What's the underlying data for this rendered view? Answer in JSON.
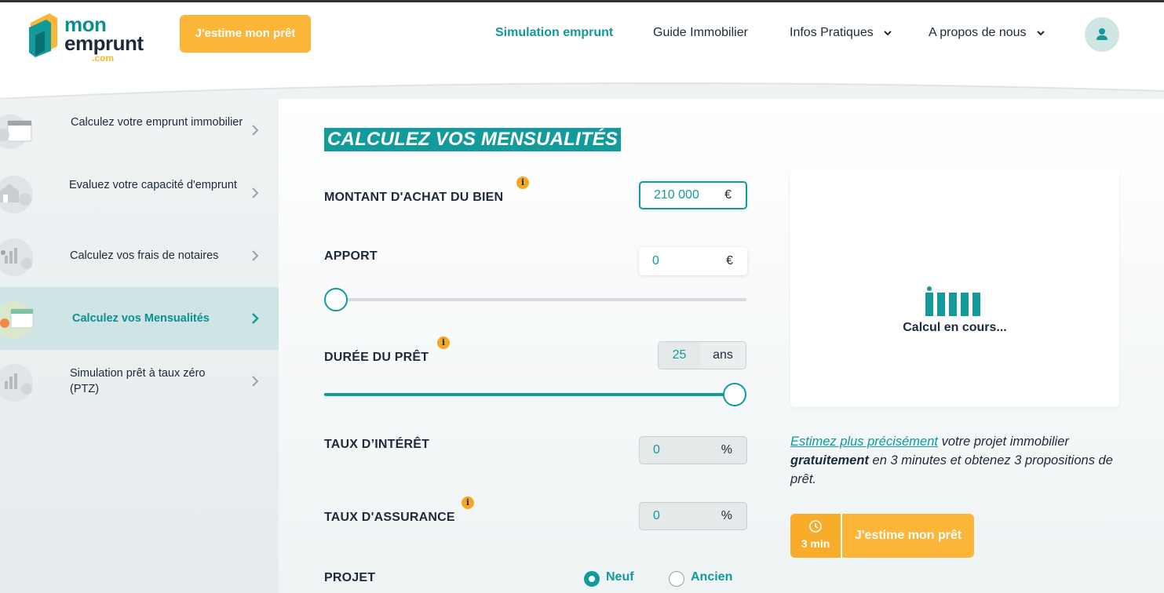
{
  "header": {
    "logo": {
      "line1": "mon",
      "line2": "emprunt",
      "line3": ".com"
    },
    "cta_label": "J'estime mon prêt",
    "nav": [
      {
        "label": "Simulation emprunt",
        "active": true
      },
      {
        "label": "Guide Immobilier"
      },
      {
        "label": "Infos Pratiques",
        "dropdown": true
      },
      {
        "label": "A propos de nous",
        "dropdown": true
      }
    ],
    "user_icon": "user-icon"
  },
  "sidebar": {
    "items": [
      {
        "label": "Calculez votre emprunt immobilier",
        "icon": "calendar-thumb-icon"
      },
      {
        "label": "Evaluez votre capacité d'emprunt",
        "icon": "house-thumb-icon"
      },
      {
        "label": "Calculez vos frais de notaires",
        "icon": "chart-thumb-icon"
      },
      {
        "label": "Calculez vos Mensualités",
        "icon": "calendar-thumb-icon",
        "active": true
      },
      {
        "label": "Simulation prêt à taux zéro (PTZ)",
        "icon": "chart-thumb-icon"
      }
    ]
  },
  "form": {
    "title": "CALCULEZ VOS MENSUALITÉS",
    "montant": {
      "label": "MONTANT D'ACHAT DU BIEN",
      "value": "210 000",
      "unit": "€"
    },
    "apport": {
      "label": "APPORT",
      "value": "0",
      "unit": "€",
      "slider_fraction": 0
    },
    "duree": {
      "label": "DURÉE DU PRÊT",
      "value": "25",
      "unit": "ans",
      "slider_fraction": 1
    },
    "taux_interet": {
      "label": "TAUX D’INTÉRÊT",
      "value": "0",
      "unit": "%"
    },
    "taux_assurance": {
      "label": "TAUX D'ASSURANCE",
      "value": "0",
      "unit": "%"
    },
    "projet": {
      "label": "PROJET",
      "options": [
        "Neuf",
        "Ancien"
      ],
      "selected": "Neuf"
    },
    "info_glyph": "i"
  },
  "result": {
    "loading_text": "Calcul en cours..."
  },
  "promo": {
    "link": "Estimez plus précisément",
    "text1": " votre projet immobilier ",
    "bold": "gratuitement",
    "text2": " en 3 minutes et obtenez 3 propositions de prêt.",
    "cta_time": "3 min",
    "cta_label": "J'estime mon prêt"
  },
  "colors": {
    "accent": "#139a9b",
    "cta": "#fbb538",
    "text": "#1d2a3a",
    "info": "#f5a623"
  }
}
